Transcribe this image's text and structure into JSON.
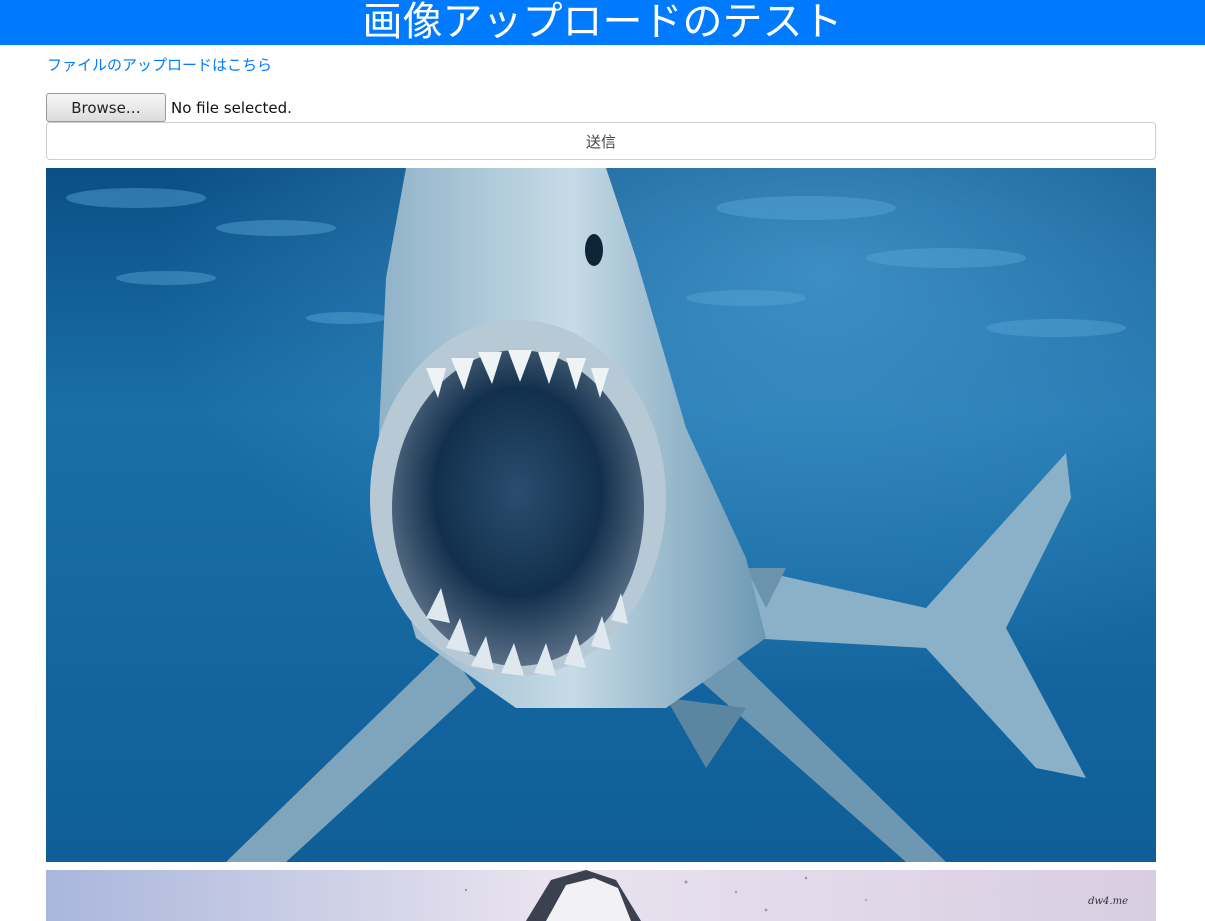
{
  "header": {
    "title": "画像アップロードのテスト"
  },
  "upload_link": {
    "label": "ファイルのアップロードはこちら"
  },
  "file_input": {
    "browse_label": "Browse…",
    "status": "No file selected."
  },
  "submit": {
    "label": "送信"
  },
  "images": [
    {
      "subject": "shark-underwater"
    },
    {
      "subject": "shark-breaching",
      "watermark": "dw4.me"
    }
  ],
  "colors": {
    "accent": "#007bff",
    "ocean": "#1a6fa8"
  }
}
